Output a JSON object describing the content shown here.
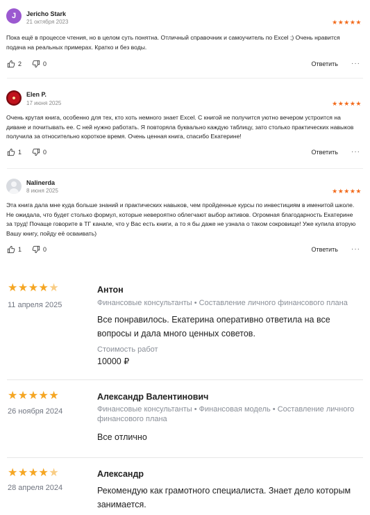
{
  "reviews": [
    {
      "author": "Jericho Stark",
      "avatar_letter": "J",
      "date": "21 октября 2023",
      "stars": "★★★★★",
      "text": "Пока ещё в процессе чтения, но в целом суть понятна. Отличный справочник и самоучитель по Excel ;) Очень нравится подача на реальных примерах. Кратко и без воды.",
      "likes": "2",
      "dislikes": "0",
      "reply": "Ответить",
      "more": "···"
    },
    {
      "author": "Elen P.",
      "date": "17 июня 2025",
      "stars": "★★★★★",
      "text": "Очень крутая книга, особенно для тех, кто хоть немного знает Excel. С книгой не получится уютно вечером устроится на диване и почитывать ее. С ней нужно работать. Я повторяла буквально каждую таблицу, зато столько практических навыков получила за относительно короткое время. Очень ценная книга, спасибо Екатерине!",
      "likes": "1",
      "dislikes": "0",
      "reply": "Ответить",
      "more": "···"
    },
    {
      "author": "Nalinerda",
      "date": "8 июня 2025",
      "stars": "★★★★★",
      "text": "Эта книга дала мне куда больше знаний и практических навыков, чем пройденные курсы по инвестициям в именитой школе. Не ожидала, что будет столько формул, которые невероятно облегчают выбор активов. Огромная благодарность Екатерине за труд! Почаще говорите в ТГ канале, что у Вас есть книги, а то я бы даже не узнала о таком сокровище! Уже купила вторую Вашу книгу, пойду её осваивать)",
      "likes": "1",
      "dislikes": "0",
      "reply": "Ответить",
      "more": "···"
    }
  ],
  "specialist_reviews": [
    {
      "stars": "★★★★",
      "half_star": "★",
      "date": "11 апреля 2025",
      "name": "Антон",
      "categories": "Финансовые консультанты • Составление личного финансового плана",
      "text": "Все понравилось. Екатерина оперативно ответила на все вопросы и дала много ценных советов.",
      "cost_label": "Стоимость работ",
      "cost": "10000 ₽"
    },
    {
      "stars": "★★★★★",
      "date": "26 ноября 2024",
      "name": "Александр Валентинович",
      "categories": "Финансовые консультанты • Финансовая модель • Составление личного финансового плана",
      "text": "Все отлично"
    },
    {
      "stars": "★★★★",
      "half_star": "★",
      "date": "28 апреля 2024",
      "name": "Александр",
      "text": "Рекомендую как грамотного специалиста. Знает дело которым занимается."
    }
  ],
  "colors": {
    "review_stars": "#f26a1b",
    "specialist_stars": "#f5a623",
    "muted_text": "#8a8f98"
  }
}
